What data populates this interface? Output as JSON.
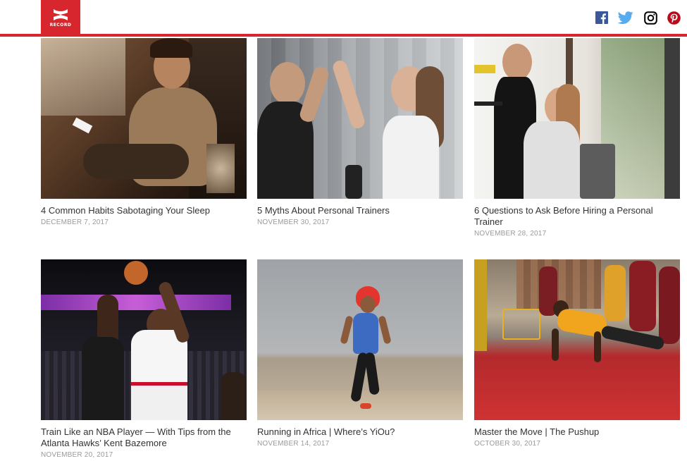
{
  "brand": {
    "logo_word": "RECORD",
    "accent": "#d8262e"
  },
  "social": [
    {
      "name": "facebook-icon",
      "color": "#3b5998"
    },
    {
      "name": "twitter-icon",
      "color": "#55acee"
    },
    {
      "name": "instagram-icon",
      "color": "#000000"
    },
    {
      "name": "pinterest-icon",
      "color": "#bd081c"
    }
  ],
  "articles": [
    {
      "title": "4 Common Habits Sabotaging Your Sleep",
      "date": "DECEMBER 7, 2017"
    },
    {
      "title": "5 Myths About Personal Trainers",
      "date": "NOVEMBER 30, 2017"
    },
    {
      "title": "6 Questions to Ask Before Hiring a Personal Trainer",
      "date": "NOVEMBER 28, 2017"
    },
    {
      "title": "Train Like an NBA Player — With Tips from the Atlanta Hawks’ Kent Bazemore",
      "date": "NOVEMBER 20, 2017"
    },
    {
      "title": "Running in Africa | Where’s YiOu?",
      "date": "NOVEMBER 14, 2017"
    },
    {
      "title": "Master the Move | The Pushup",
      "date": "OCTOBER 30, 2017"
    }
  ]
}
